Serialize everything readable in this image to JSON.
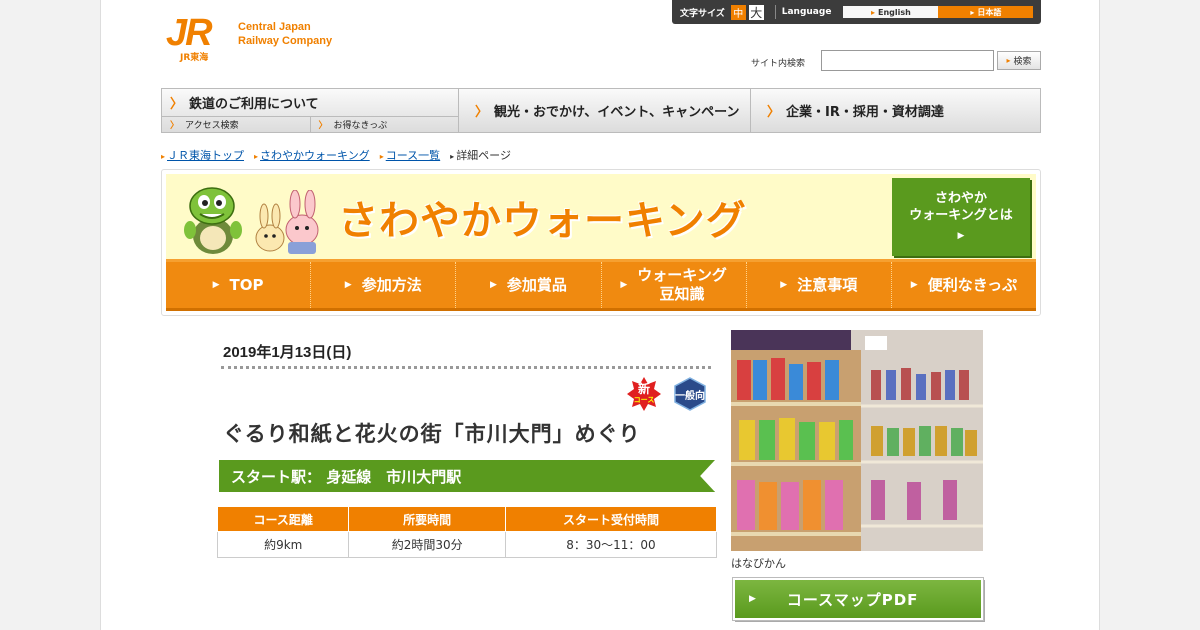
{
  "logo": {
    "mark": "JR",
    "sub": "JR東海",
    "name_line1": "Central Japan",
    "name_line2": "Railway Company"
  },
  "util": {
    "font_size_label": "文字サイズ",
    "size_mid": "中",
    "size_big": "大",
    "language_label": "Language",
    "english": "English",
    "japanese": "日本語"
  },
  "search": {
    "label": "サイト内検索",
    "value": "",
    "button": "検索"
  },
  "gnav": {
    "rail": "鉄道のご利用について",
    "access": "アクセス検索",
    "tickets": "お得なきっぷ",
    "tourism": "観光・おでかけ、イベント、キャンペーン",
    "corporate": "企業・IR・採用・資材調達"
  },
  "breadcrumb": {
    "home": "ＪＲ東海トップ",
    "walking": "さわやかウォーキング",
    "list": "コース一覧",
    "current": "詳細ページ"
  },
  "banner": {
    "title": "さわやかウォーキング",
    "about_line1": "さわやか",
    "about_line2": "ウォーキングとは"
  },
  "subnav": {
    "top": "TOP",
    "how": "参加方法",
    "prizes": "参加賞品",
    "tips_line1": "ウォーキング",
    "tips_line2": "豆知識",
    "notes": "注意事項",
    "tickets": "便利なきっぷ"
  },
  "event": {
    "date": "2019年1月13日(日)",
    "badge_new": "新",
    "badge_new_sub": "コース",
    "badge_general": "一般向",
    "title": "ぐるり和紙と花火の街「市川大門」めぐり",
    "start_station": "スタート駅： 身延線　市川大門駅",
    "table_headers": [
      "コース距離",
      "所要時間",
      "スタート受付時間"
    ],
    "table_values": [
      "約9km",
      "約2時間30分",
      "8：30～11：00"
    ],
    "photo_caption": "はなびかん",
    "map_button": "コースマップPDF"
  },
  "colors": {
    "orange": "#f08000",
    "green": "#5a9a1e"
  }
}
